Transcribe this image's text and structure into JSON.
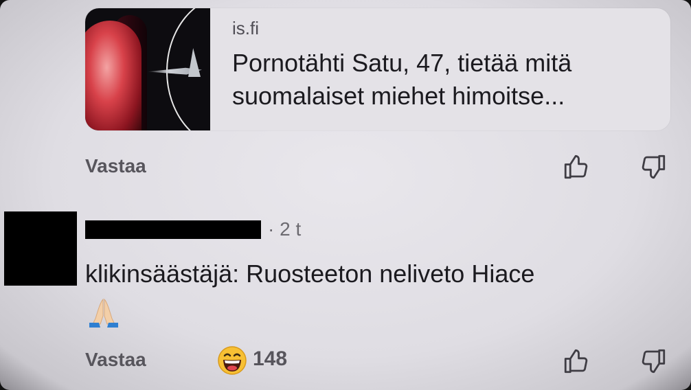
{
  "link_preview": {
    "domain": "is.fi",
    "headline": "Pornotähti Satu, 47, tietää mitä suomalaiset miehet himoitse..."
  },
  "parent_comment_actions": {
    "reply_label": "Vastaa",
    "like_icon": "thumbs-up-icon",
    "dislike_icon": "thumbs-down-icon"
  },
  "comment": {
    "time": "· 2 t",
    "text": "klikinsäästäjä: Ruosteeton neliveto Hiace",
    "emoji_icon": "folded-hands-icon",
    "reply_label": "Vastaa",
    "reaction_icon": "laughing-face-icon",
    "reaction_count": "148",
    "like_icon": "thumbs-up-icon",
    "dislike_icon": "thumbs-down-icon"
  }
}
